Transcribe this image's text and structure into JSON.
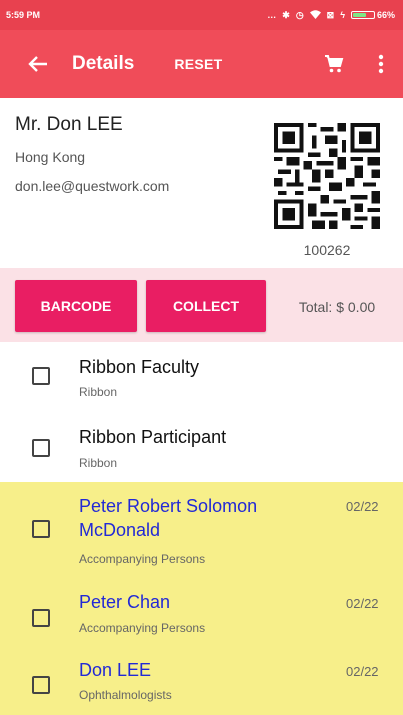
{
  "status_bar": {
    "time": "5:59 PM",
    "icons": [
      "more-dots-icon",
      "bluetooth-icon",
      "alarm-icon",
      "wifi-icon",
      "sim-icon",
      "charging-icon"
    ],
    "battery_percent": 0.66,
    "battery_label": "66%"
  },
  "app_bar": {
    "back_icon": "arrow-left-icon",
    "title": "Details",
    "reset_label": "RESET",
    "cart_icon": "shopping-cart-icon",
    "menu_icon": "more-vertical-icon",
    "color": "#f04c59"
  },
  "profile": {
    "name": "Mr. Don LEE",
    "city": "Hong Kong",
    "email": "don.lee@questwork.com",
    "member_id": "100262"
  },
  "actions": {
    "barcode_label": "BARCODE",
    "collect_label": "COLLECT",
    "total_label": "Total: $ 0.00",
    "button_color": "#e91e63",
    "background_color": "#fbe1e6"
  },
  "items": [
    {
      "title": "Ribbon Faculty",
      "subtitle": "Ribbon",
      "date": "",
      "highlighted": false,
      "checked": false
    },
    {
      "title": "Ribbon Participant",
      "subtitle": "Ribbon",
      "date": "",
      "highlighted": false,
      "checked": false
    },
    {
      "title": "Peter Robert Solomon McDonald",
      "subtitle": "Accompanying Persons",
      "date": "02/22",
      "highlighted": true,
      "checked": false
    },
    {
      "title": "Peter Chan",
      "subtitle": "Accompanying Persons",
      "date": "02/22",
      "highlighted": true,
      "checked": false
    },
    {
      "title": "Don LEE",
      "subtitle": "Ophthalmologists",
      "date": "02/22",
      "highlighted": true,
      "checked": false
    }
  ],
  "colors": {
    "highlight": "#f7ef8a",
    "person_name": "#2229d6"
  }
}
